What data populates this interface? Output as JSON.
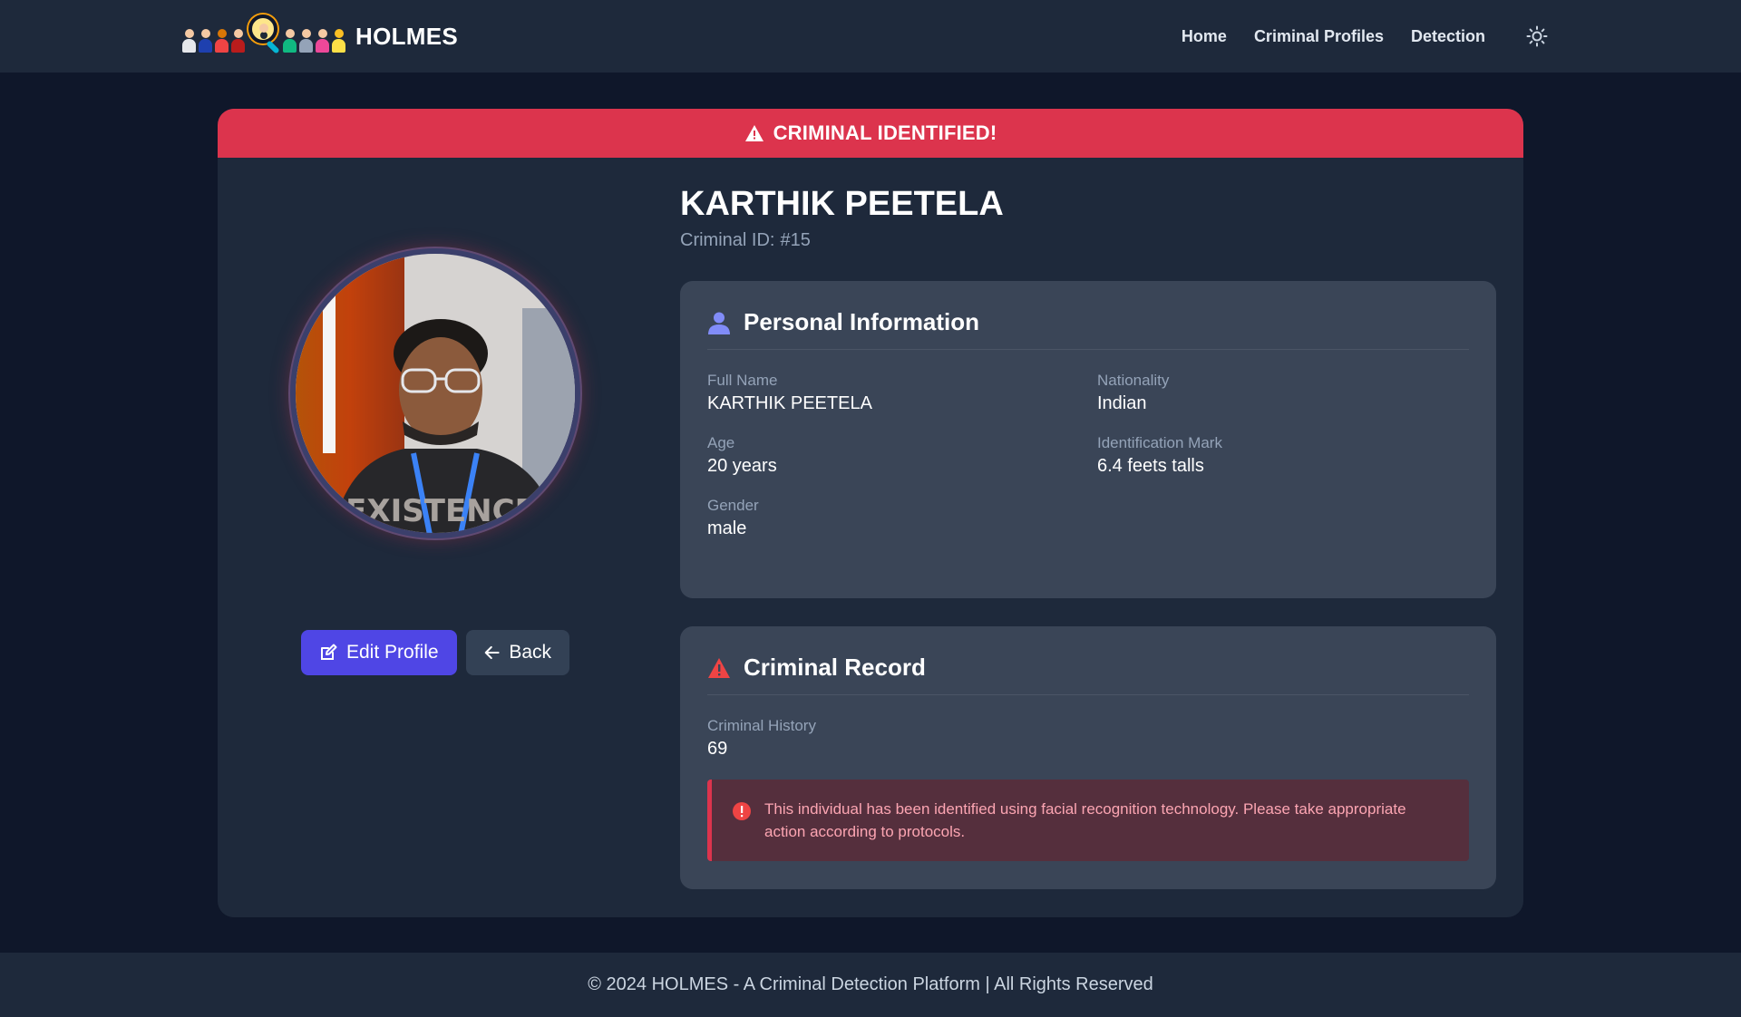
{
  "navbar": {
    "brand_name": "HOLMES",
    "links": [
      {
        "label": "Home"
      },
      {
        "label": "Criminal Profiles"
      },
      {
        "label": "Detection"
      }
    ],
    "theme_icon": "sun-icon"
  },
  "alert": {
    "icon": "warning-icon",
    "text": "CRIMINAL IDENTIFIED!",
    "color": "#dc344d"
  },
  "profile": {
    "name": "KARTHIK PEETELA",
    "id_label": "Criminal ID:",
    "id_value": "#15",
    "photo_icon": "profile-photo"
  },
  "actions": {
    "edit_label": "Edit Profile",
    "edit_icon": "edit-icon",
    "back_label": "Back",
    "back_icon": "arrow-left-icon",
    "primary_color": "#4f46e5"
  },
  "personal_info": {
    "title": "Personal Information",
    "icon": "user-icon",
    "fields": {
      "full_name": {
        "label": "Full Name",
        "value": "KARTHIK PEETELA"
      },
      "nationality": {
        "label": "Nationality",
        "value": "Indian"
      },
      "age": {
        "label": "Age",
        "value": "20 years"
      },
      "identification_mark": {
        "label": "Identification Mark",
        "value": "6.4 feets talls"
      },
      "gender": {
        "label": "Gender",
        "value": "male"
      }
    }
  },
  "criminal_record": {
    "title": "Criminal Record",
    "icon": "warning-icon",
    "history_label": "Criminal History",
    "history_value": "69",
    "notice_icon": "exclamation-circle-icon",
    "notice_text": "This individual has been identified using facial recognition technology. Please take appropriate action according to protocols."
  },
  "footer": {
    "text": "© 2024 HOLMES - A Criminal Detection Platform | All Rights Reserved"
  }
}
